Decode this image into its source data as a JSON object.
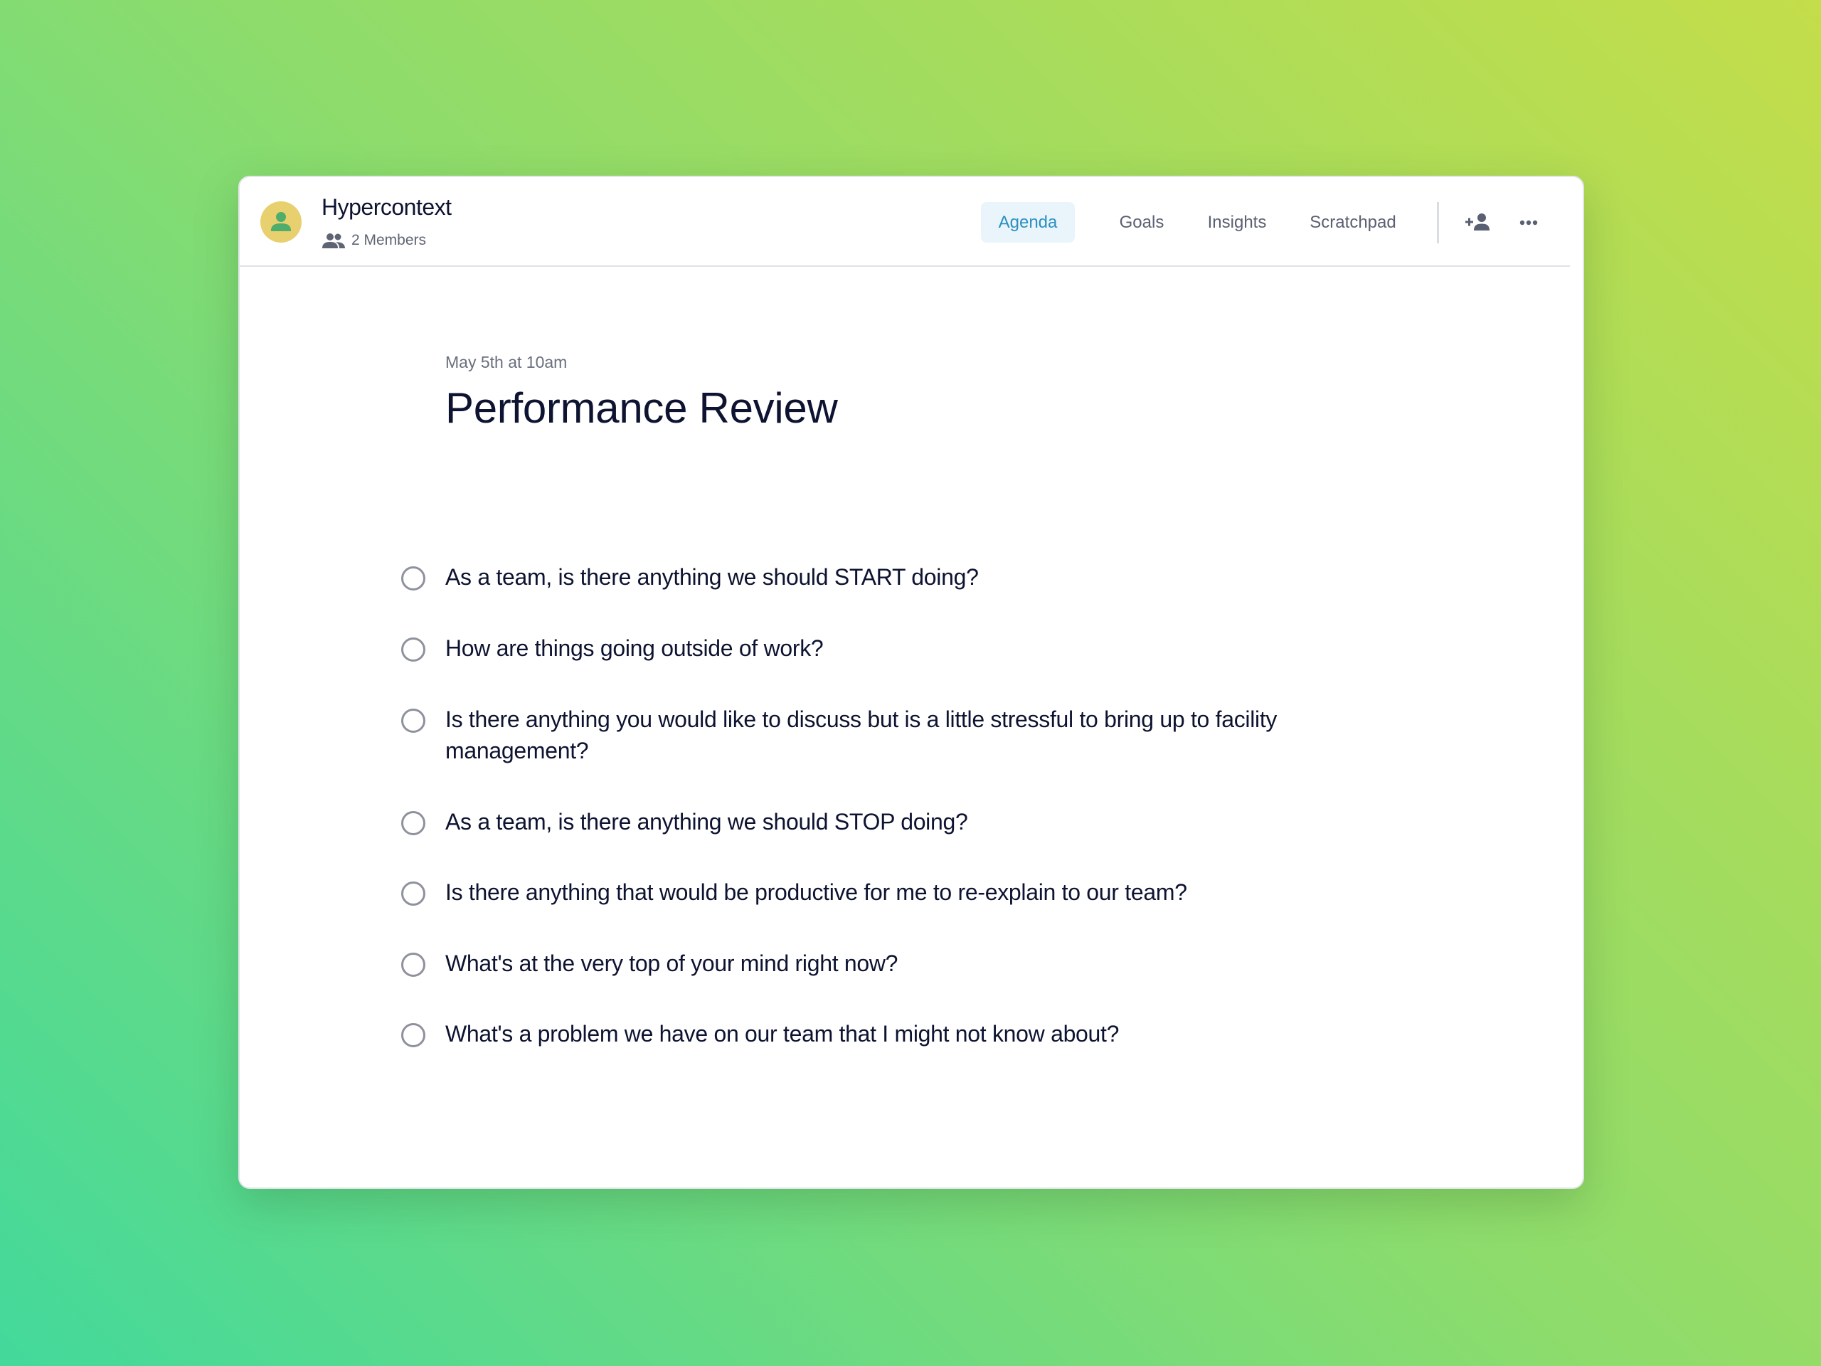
{
  "header": {
    "app_title": "Hypercontext",
    "members_label": "2 Members",
    "avatar_icon": "person-icon",
    "members_icon": "people-icon"
  },
  "nav": {
    "tabs": [
      {
        "label": "Agenda",
        "active": true
      },
      {
        "label": "Goals",
        "active": false
      },
      {
        "label": "Insights",
        "active": false
      },
      {
        "label": "Scratchpad",
        "active": false
      }
    ],
    "actions": [
      {
        "icon": "add-person-icon"
      },
      {
        "icon": "more-horizontal-icon"
      }
    ]
  },
  "meeting": {
    "date": "May 5th at 10am",
    "title": "Performance Review"
  },
  "agenda": {
    "items": [
      {
        "text": "As a team, is there anything we should START doing?",
        "checked": false
      },
      {
        "text": "How are things going outside of work?",
        "checked": false
      },
      {
        "text": "Is there anything you would like to discuss but is a little stressful to bring up to facility management?",
        "checked": false
      },
      {
        "text": "As a team, is there anything we should STOP doing?",
        "checked": false
      },
      {
        "text": "Is there anything that would be productive for me to re-explain to our team?",
        "checked": false
      },
      {
        "text": "What's at the very top of your mind right now?",
        "checked": false
      },
      {
        "text": "What's a problem we have on our team that I might not know about?",
        "checked": false
      }
    ]
  },
  "colors": {
    "accent": "#2b8fc1",
    "accent_bg": "#e9f4fb",
    "text_primary": "#0d1330",
    "text_muted": "#5a6072",
    "avatar_bg": "#e8d06e",
    "avatar_figure": "#4fae6b"
  }
}
